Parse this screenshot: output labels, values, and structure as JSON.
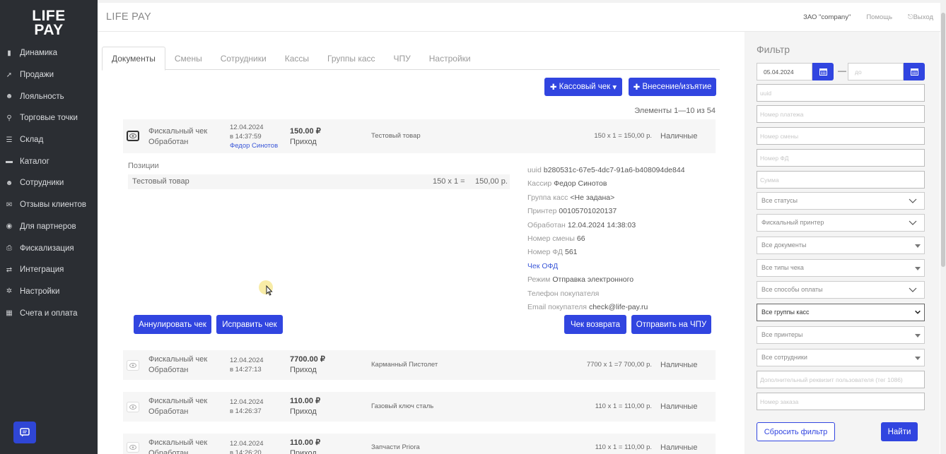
{
  "logo": {
    "line1": "LIFE",
    "line2": "PAY"
  },
  "sidebar": {
    "items": [
      {
        "label": "Динамика",
        "icon": "bar-chart-icon"
      },
      {
        "label": "Продажи",
        "icon": "rocket-icon"
      },
      {
        "label": "Лояльность",
        "icon": "users-icon"
      },
      {
        "label": "Торговые точки",
        "icon": "map-marker-icon"
      },
      {
        "label": "Склад",
        "icon": "database-icon"
      },
      {
        "label": "Каталог",
        "icon": "folder-icon"
      },
      {
        "label": "Сотрудники",
        "icon": "users-icon"
      },
      {
        "label": "Отзывы клиентов",
        "icon": "comments-icon"
      },
      {
        "label": "Для партнеров",
        "icon": "eye-icon"
      },
      {
        "label": "Фискализация",
        "icon": "printer-icon"
      },
      {
        "label": "Интеграция",
        "icon": "exchange-icon"
      },
      {
        "label": "Настройки",
        "icon": "gears-icon"
      },
      {
        "label": "Счета и оплата",
        "icon": "calculator-icon"
      }
    ]
  },
  "header": {
    "title": "LIFE PAY",
    "company": "ЗАО \"company\"",
    "help": "Помощь",
    "exit": "Выход"
  },
  "tabs": [
    "Документы",
    "Смены",
    "Сотрудники",
    "Кассы",
    "Группы касс",
    "ЧПУ",
    "Настройки"
  ],
  "actions": {
    "receipt": "Кассовый чек",
    "cash": "Внесение/изъятие",
    "counter": "Элементы 1—10 из 54"
  },
  "documents": [
    {
      "type": "Фискальный чек",
      "status": "Обработан",
      "date": "12.04.2024",
      "time": "в 14:37:59",
      "cashier": "Федор Синотов",
      "amount": "150.00 ₽",
      "op": "Приход",
      "product": "Тестовый товар",
      "calc": "150 x 1 =   150,00 р.",
      "pay": "Наличные"
    },
    {
      "type": "Фискальный чек",
      "status": "Обработан",
      "date": "12.04.2024",
      "time": "в 14:27:13",
      "amount": "7700.00 ₽",
      "op": "Приход",
      "product": "Карманный Пистолет",
      "calc": "7700 x 1 =7 700,00 р.",
      "pay": "Наличные"
    },
    {
      "type": "Фискальный чек",
      "status": "Обработан",
      "date": "12.04.2024",
      "time": "в 14:26:37",
      "amount": "110.00 ₽",
      "op": "Приход",
      "product": "Газовый ключ сталь",
      "calc": "110 x 1 =   110,00 р.",
      "pay": "Наличные"
    },
    {
      "type": "Фискальный чек",
      "status": "Обработан",
      "date": "12.04.2024",
      "time": "в 14:26:20",
      "amount": "110.00 ₽",
      "op": "Приход",
      "product": "Запчасти Priora",
      "calc": "110 x 1 =   110,00 р.",
      "pay": "Наличные"
    }
  ],
  "expanded": {
    "positions_title": "Позиции",
    "position": {
      "name": "Тестовый товар",
      "qty": "150 x 1 =",
      "sum": "150,00 р."
    },
    "details": {
      "uuid_label": "uuid",
      "uuid": "b280531c-67e5-4dc7-91a6-b408094de844",
      "cashier_label": "Кассир",
      "cashier": "Федор Синотов",
      "group_label": "Группа касс",
      "group": "<Не задана>",
      "printer_label": "Принтер",
      "printer": "00105701020137",
      "processed_label": "Обработан",
      "processed": "12.04.2024 14:38:03",
      "shift_label": "Номер смены",
      "shift": "66",
      "fd_label": "Номер ФД",
      "fd": "561",
      "ofd_link": "Чек ОФД",
      "mode_label": "Режим",
      "mode": "Отправка электронного",
      "phone_label": "Телефон покупателя",
      "email_label": "Email покупателя",
      "email": "check@life-pay.ru"
    },
    "buttons": {
      "annul": "Аннулировать чек",
      "fix": "Исправить чек",
      "return": "Чек возврата",
      "send": "Отправить на ЧПУ"
    }
  },
  "filter": {
    "title": "Фильтр",
    "date_from": "05.04.2024",
    "date_to_placeholder": "до",
    "inputs": [
      "uuid",
      "Номер платежа",
      "Номер смены",
      "Номер ФД",
      "Сумма"
    ],
    "selects": [
      "Все статусы",
      "Фискальный принтер",
      "Все документы",
      "Все типы чека",
      "Все способы оплаты",
      "Все группы касс",
      "Все принтеры",
      "Все сотрудники"
    ],
    "extra_inputs": [
      "Дополнительный реквизит пользователя (тег 1086)",
      "Номер заказа"
    ],
    "reset": "Сбросить фильтр",
    "find": "Найти"
  }
}
